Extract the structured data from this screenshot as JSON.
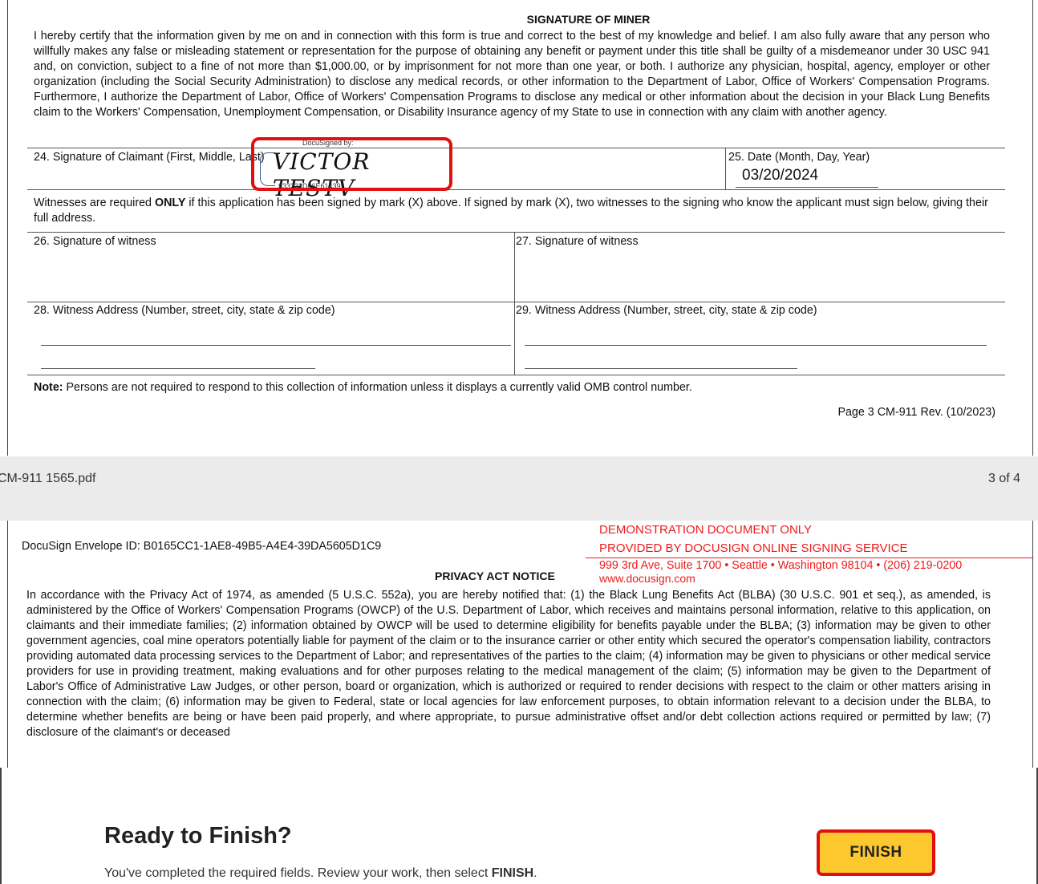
{
  "page3": {
    "section_title": "SIGNATURE OF MINER",
    "certification_text": "I hereby certify that the information given by me on and in connection with this form is true and correct to the best of my knowledge and belief.  I am also  fully aware that any person who willfully makes any false or misleading statement or representation for the purpose of obtaining any benefit or payment under this title shall be guilty of a misdemeanor under 30 USC 941 and, on conviction, subject to a fine of not more than $1,000.00, or by imprisonment for not more than one year, or both. I authorize any physician, hospital, agency, employer or other organization (including the Social Security Administration) to disclose any medical records, or other information to the Department of Labor, Office of Workers' Compensation Programs. Furthermore, I authorize the Department of Labor, Office of Workers' Compensation Programs to disclose any medical or other information about the decision in your Black Lung Benefits claim to the Workers' Compensation, Unemployment Compensation, or Disability Insurance agency of my State to use in connection with any claim with another agency.",
    "field24_label": "24. Signature of Claimant (First, Middle, Last)",
    "signature": {
      "header": "DocuSigned by:",
      "name": "VICTOR TESTV",
      "id": "933233D66E61439..."
    },
    "field25_label": "25. Date (Month, Day, Year)",
    "date_value": "03/20/2024",
    "witness_prefix": "Witnesses are required ",
    "witness_only": "ONLY",
    "witness_rest": " if this application has been signed by mark (X) above.  If signed by mark (X), two witnesses to the signing who know the applicant must sign below, giving their full address.",
    "field26_label": "26. Signature of witness",
    "field27_label": "27. Signature of witness",
    "field28_label": "28. Witness Address (Number, street, city, state & zip code)",
    "field29_label": "29. Witness Address (Number, street, city, state & zip code)",
    "note_label": "Note:",
    "note_text": " Persons are not required to respond to this collection of information unless it displays a currently valid OMB control number.",
    "page_footer": "Page 3 CM-911 Rev. (10/2023)"
  },
  "viewer": {
    "filename": "CM-911 1565.pdf",
    "page_indicator": "3 of 4"
  },
  "page4": {
    "envelope_id": "DocuSign Envelope ID: B0165CC1-1AE8-49B5-A4E4-39DA5605D1C9",
    "demo_line1": "DEMONSTRATION DOCUMENT ONLY",
    "demo_line2": "PROVIDED BY DOCUSIGN ONLINE SIGNING SERVICE",
    "demo_line3": "999 3rd Ave, Suite 1700  • Seattle • Washington 98104 • (206) 219-0200",
    "demo_line4": "www.docusign.com",
    "section_title": "PRIVACY ACT NOTICE",
    "privacy_text": "In accordance with the Privacy Act of 1974, as amended (5 U.S.C. 552a), you are hereby notified that: (1) the Black Lung Benefits Act (BLBA) (30 U.S.C. 901 et seq.), as amended, is administered by the Office of Workers' Compensation Programs (OWCP) of the U.S. Department of Labor, which receives and maintains personal information, relative to this application, on claimants and their immediate families; (2) information obtained by OWCP will be used to determine eligibility for benefits payable under the BLBA; (3) information may be given to other government agencies, coal mine operators potentially liable for payment of the claim or to the insurance carrier or other entity which secured the operator's compensation liability, contractors providing automated data processing services to the Department of Labor; and representatives of the parties to the claim; (4) information may be given to physicians or other medical service providers for use in providing treatment, making evaluations and for other purposes relating to the medical management of the claim; (5) information may be given to the Department of Labor's Office of Administrative Law Judges, or other person, board or organization, which is authorized or required to render decisions with respect to the claim or other matters arising in connection with the claim; (6) information may be given to Federal, state or local agencies for law enforcement purposes, to obtain information relevant to a decision under the BLBA, to determine whether benefits are being or have been paid properly, and where appropriate, to pursue administrative offset and/or debt collection actions required or permitted by law; (7) disclosure of the claimant's or deceased"
  },
  "finish_panel": {
    "title": "Ready to Finish?",
    "message_prefix": "You've completed the required fields. Review your work, then select ",
    "message_bold": "FINISH",
    "message_suffix": ".",
    "button_label": "FINISH"
  },
  "colors": {
    "highlight": "#e01010",
    "finish_button": "#fdc72e",
    "demo_text": "#ee1c1c"
  }
}
